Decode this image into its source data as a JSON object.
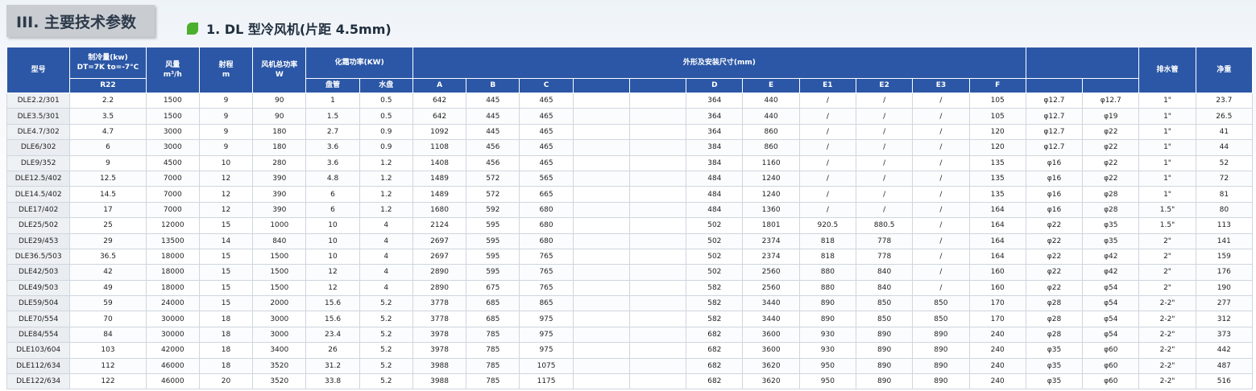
{
  "section": {
    "title": "III. 主要技术参数"
  },
  "subtitle": "1. DL 型冷风机(片距 4.5mm)",
  "colors": {
    "header_bg": "#2b57a6",
    "accent_green": "#4caf2e"
  },
  "headers": {
    "model": "型号",
    "capacity_line1": "制冷量(kw)",
    "capacity_line2": "DT=7K to=-7°C",
    "capacity_r22": "R22",
    "airflow_line1": "风量",
    "airflow_line2": "m³/h",
    "throw_line1": "射程",
    "throw_line2": "m",
    "fanpower_line1": "风机总功率",
    "fanpower_line2": "W",
    "defrost": "化霜功率(KW)",
    "coil": "盘管",
    "tray": "水盘",
    "dims": "外形及安装尺寸(mm)",
    "A": "A",
    "B": "B",
    "C": "C",
    "D": "D",
    "E": "E",
    "E1": "E1",
    "E2": "E2",
    "E3": "E3",
    "F": "F",
    "drain": "排水管",
    "weight": "净重"
  },
  "rows": [
    [
      "DLE2.2/301",
      "2.2",
      "1500",
      "9",
      "90",
      "1",
      "0.5",
      "642",
      "445",
      "465",
      "",
      "",
      "364",
      "440",
      "/",
      "/",
      "/",
      "105",
      "φ12.7",
      "φ12.7",
      "1\"",
      "23.7"
    ],
    [
      "DLE3.5/301",
      "3.5",
      "1500",
      "9",
      "90",
      "1.5",
      "0.5",
      "642",
      "445",
      "465",
      "",
      "",
      "364",
      "440",
      "/",
      "/",
      "/",
      "105",
      "φ12.7",
      "φ19",
      "1\"",
      "26.5"
    ],
    [
      "DLE4.7/302",
      "4.7",
      "3000",
      "9",
      "180",
      "2.7",
      "0.9",
      "1092",
      "445",
      "465",
      "",
      "",
      "364",
      "860",
      "/",
      "/",
      "/",
      "120",
      "φ12.7",
      "φ22",
      "1\"",
      "41"
    ],
    [
      "DLE6/302",
      "6",
      "3000",
      "9",
      "180",
      "3.6",
      "0.9",
      "1108",
      "456",
      "465",
      "",
      "",
      "384",
      "860",
      "/",
      "/",
      "/",
      "120",
      "φ12.7",
      "φ22",
      "1\"",
      "44"
    ],
    [
      "DLE9/352",
      "9",
      "4500",
      "10",
      "280",
      "3.6",
      "1.2",
      "1408",
      "456",
      "465",
      "",
      "",
      "384",
      "1160",
      "/",
      "/",
      "/",
      "135",
      "φ16",
      "φ22",
      "1\"",
      "52"
    ],
    [
      "DLE12.5/402",
      "12.5",
      "7000",
      "12",
      "390",
      "4.8",
      "1.2",
      "1489",
      "572",
      "565",
      "",
      "",
      "484",
      "1240",
      "/",
      "/",
      "/",
      "135",
      "φ16",
      "φ22",
      "1\"",
      "72"
    ],
    [
      "DLE14.5/402",
      "14.5",
      "7000",
      "12",
      "390",
      "6",
      "1.2",
      "1489",
      "572",
      "665",
      "",
      "",
      "484",
      "1240",
      "/",
      "/",
      "/",
      "135",
      "φ16",
      "φ28",
      "1\"",
      "81"
    ],
    [
      "DLE17/402",
      "17",
      "7000",
      "12",
      "390",
      "6",
      "1.2",
      "1680",
      "592",
      "680",
      "",
      "",
      "484",
      "1360",
      "/",
      "/",
      "/",
      "164",
      "φ16",
      "φ28",
      "1.5\"",
      "80"
    ],
    [
      "DLE25/502",
      "25",
      "12000",
      "15",
      "1000",
      "10",
      "4",
      "2124",
      "595",
      "680",
      "",
      "",
      "502",
      "1801",
      "920.5",
      "880.5",
      "/",
      "164",
      "φ22",
      "φ35",
      "1.5\"",
      "113"
    ],
    [
      "DLE29/453",
      "29",
      "13500",
      "14",
      "840",
      "10",
      "4",
      "2697",
      "595",
      "680",
      "",
      "",
      "502",
      "2374",
      "818",
      "778",
      "/",
      "164",
      "φ22",
      "φ35",
      "2\"",
      "141"
    ],
    [
      "DLE36.5/503",
      "36.5",
      "18000",
      "15",
      "1500",
      "10",
      "4",
      "2697",
      "595",
      "765",
      "",
      "",
      "502",
      "2374",
      "818",
      "778",
      "/",
      "164",
      "φ22",
      "φ42",
      "2\"",
      "159"
    ],
    [
      "DLE42/503",
      "42",
      "18000",
      "15",
      "1500",
      "12",
      "4",
      "2890",
      "595",
      "765",
      "",
      "",
      "502",
      "2560",
      "880",
      "840",
      "/",
      "160",
      "φ22",
      "φ42",
      "2\"",
      "176"
    ],
    [
      "DLE49/503",
      "49",
      "18000",
      "15",
      "1500",
      "12",
      "4",
      "2890",
      "675",
      "765",
      "",
      "",
      "582",
      "2560",
      "880",
      "840",
      "/",
      "160",
      "φ22",
      "φ54",
      "2\"",
      "190"
    ],
    [
      "DLE59/504",
      "59",
      "24000",
      "15",
      "2000",
      "15.6",
      "5.2",
      "3778",
      "685",
      "865",
      "",
      "",
      "582",
      "3440",
      "890",
      "850",
      "850",
      "170",
      "φ28",
      "φ54",
      "2-2\"",
      "277"
    ],
    [
      "DLE70/554",
      "70",
      "30000",
      "18",
      "3000",
      "15.6",
      "5.2",
      "3778",
      "685",
      "975",
      "",
      "",
      "582",
      "3440",
      "890",
      "850",
      "850",
      "170",
      "φ28",
      "φ54",
      "2-2\"",
      "312"
    ],
    [
      "DLE84/554",
      "84",
      "30000",
      "18",
      "3000",
      "23.4",
      "5.2",
      "3978",
      "785",
      "975",
      "",
      "",
      "682",
      "3600",
      "930",
      "890",
      "890",
      "240",
      "φ28",
      "φ54",
      "2-2\"",
      "373"
    ],
    [
      "DLE103/604",
      "103",
      "42000",
      "18",
      "3400",
      "26",
      "5.2",
      "3978",
      "785",
      "975",
      "",
      "",
      "682",
      "3600",
      "930",
      "890",
      "890",
      "240",
      "φ35",
      "φ60",
      "2-2\"",
      "442"
    ],
    [
      "DLE112/634",
      "112",
      "46000",
      "18",
      "3520",
      "31.2",
      "5.2",
      "3988",
      "785",
      "1075",
      "",
      "",
      "682",
      "3620",
      "950",
      "890",
      "890",
      "240",
      "φ35",
      "φ60",
      "2-2\"",
      "487"
    ],
    [
      "DLE122/634",
      "122",
      "46000",
      "20",
      "3520",
      "33.8",
      "5.2",
      "3988",
      "785",
      "1175",
      "",
      "",
      "682",
      "3620",
      "950",
      "890",
      "890",
      "240",
      "φ35",
      "φ60",
      "2-2\"",
      "516"
    ]
  ]
}
